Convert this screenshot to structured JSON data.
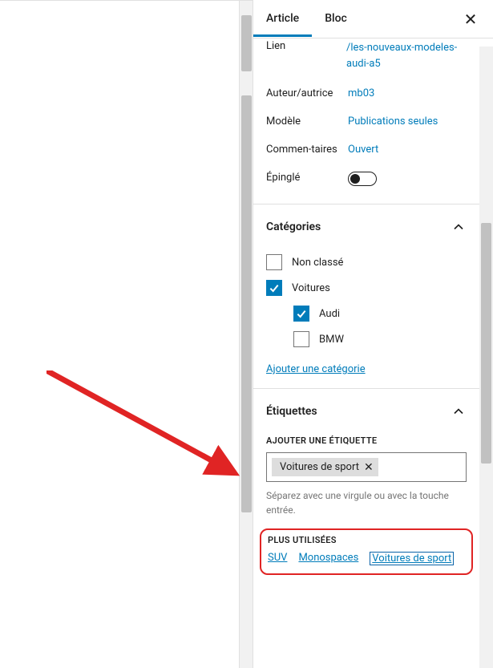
{
  "tabs": {
    "article": "Article",
    "bloc": "Bloc"
  },
  "meta": {
    "lien_label": "Lien",
    "lien_value": "/les-nouveaux-modeles-audi-a5",
    "auteur_label": "Auteur/autrice",
    "auteur_value": "mb03",
    "modele_label": "Modèle",
    "modele_value": "Publications seules",
    "commentaires_label": "Commen-taires",
    "commentaires_value": "Ouvert",
    "epingle_label": "Épinglé"
  },
  "categories": {
    "title": "Catégories",
    "items": [
      {
        "label": "Non classé",
        "checked": false,
        "indent": false
      },
      {
        "label": "Voitures",
        "checked": true,
        "indent": false
      },
      {
        "label": "Audi",
        "checked": true,
        "indent": true
      },
      {
        "label": "BMW",
        "checked": false,
        "indent": true
      }
    ],
    "add_label": "Ajouter une catégorie"
  },
  "tags": {
    "title": "Étiquettes",
    "add_label": "AJOUTER UNE ÉTIQUETTE",
    "chip": "Voitures de sport",
    "hint": "Séparez avec une virgule ou avec la touche entrée.",
    "most_used_label": "PLUS UTILISÉES",
    "most_used": [
      "SUV",
      "Monospaces",
      "Voitures de sport"
    ]
  }
}
